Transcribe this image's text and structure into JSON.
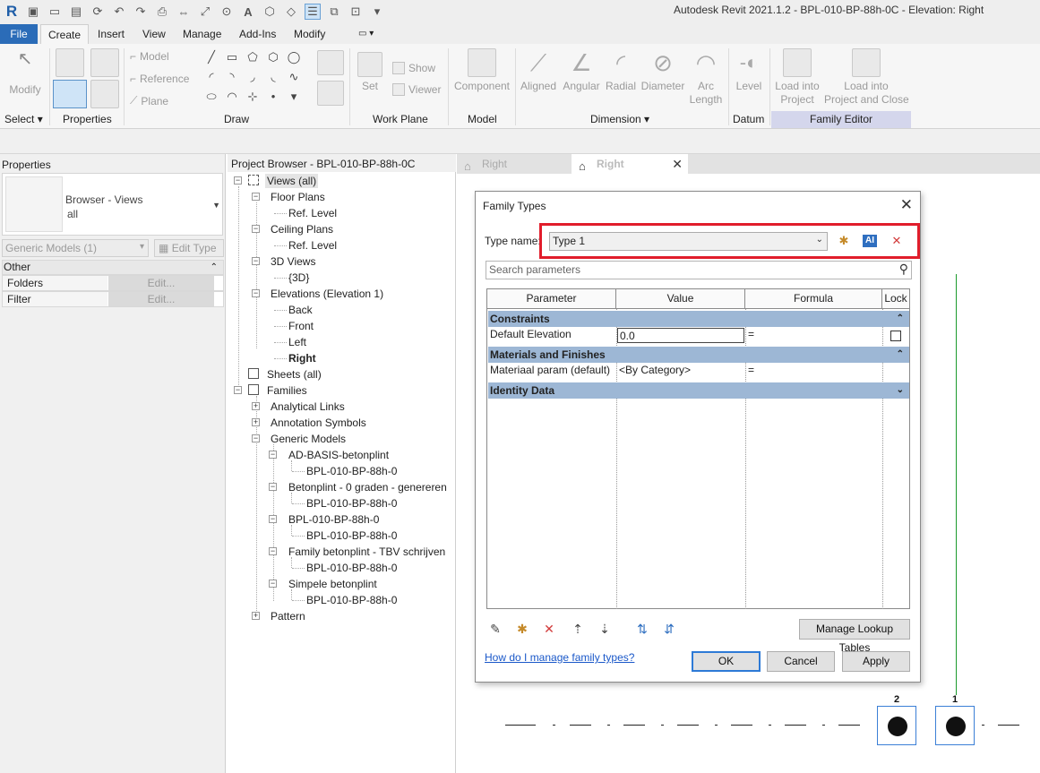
{
  "app": {
    "title": "Autodesk Revit 2021.1.2 - BPL-010-BP-88h-0C - Elevation: Right",
    "logo": "R"
  },
  "menu": {
    "tabs": [
      "File",
      "Create",
      "Insert",
      "View",
      "Manage",
      "Add-Ins",
      "Modify"
    ],
    "active": "Create"
  },
  "ribbon": {
    "modify_label": "Modify",
    "select_label": "Select",
    "properties_label": "Properties",
    "draw_label": "Draw",
    "model_line": "Model",
    "reference_line": "Reference",
    "plane": "Plane",
    "set": "Set",
    "show": "Show",
    "viewer": "Viewer",
    "work_plane_label": "Work Plane",
    "component": "Component",
    "model_label": "Model",
    "aligned": "Aligned",
    "angular": "Angular",
    "radial": "Radial",
    "diameter": "Diameter",
    "arc": "Arc",
    "length": "Length",
    "dimension_label": "Dimension",
    "level": "Level",
    "datum_label": "Datum",
    "load_into": "Load into",
    "project": "Project",
    "load_into2": "Load into",
    "project_and_close": "Project and Close",
    "family_editor_label": "Family Editor"
  },
  "properties": {
    "title": "Properties",
    "type_line1": "Browser - Views",
    "type_line2": "all",
    "filter_combo": "Generic Models (1)",
    "edit_type": "Edit Type",
    "group": "Other",
    "rows": [
      {
        "name": "Folders",
        "value": "Edit..."
      },
      {
        "name": "Filter",
        "value": "Edit..."
      }
    ]
  },
  "browser": {
    "title": "Project Browser - BPL-010-BP-88h-0C",
    "items": [
      "Views (all)",
      "Floor Plans",
      "Ref. Level",
      "Ceiling Plans",
      "Ref. Level",
      "3D Views",
      "{3D}",
      "Elevations (Elevation 1)",
      "Back",
      "Front",
      "Left",
      "Right",
      "Sheets (all)",
      "Families",
      "Analytical Links",
      "Annotation Symbols",
      "Generic Models",
      "AD-BASIS-betonplint",
      "BPL-010-BP-88h-0",
      "Betonplint - 0 graden - genereren",
      "BPL-010-BP-88h-0",
      "BPL-010-BP-88h-0",
      "BPL-010-BP-88h-0",
      "Family betonplint - TBV schrijven",
      "BPL-010-BP-88h-0",
      "Simpele betonplint",
      "BPL-010-BP-88h-0",
      "Pattern"
    ]
  },
  "viewtabs": {
    "tab1": "Right",
    "tab2": "Right"
  },
  "dialog": {
    "title": "Family Types",
    "type_name_label": "Type name:",
    "type_name": "Type 1",
    "search_placeholder": "Search parameters",
    "columns": [
      "Parameter",
      "Value",
      "Formula",
      "Lock"
    ],
    "groups": {
      "constraints": "Constraints",
      "materials": "Materials and Finishes",
      "identity": "Identity Data"
    },
    "rows": {
      "default_elevation": {
        "name": "Default Elevation",
        "value": "0.0",
        "formula": "="
      },
      "material": {
        "name": "Materiaal param (default)",
        "value": "<By Category>",
        "formula": "="
      }
    },
    "manage_lookup": "Manage Lookup Tables",
    "help_link": "How do I manage family types?",
    "ok": "OK",
    "cancel": "Cancel",
    "apply": "Apply"
  },
  "canvas": {
    "grid_bubble_1": "2",
    "grid_bubble_2": "1"
  },
  "colors": {
    "file_tab": "#2b6cb8",
    "highlight_box": "#e11d2b",
    "group_header": "#9db7d5",
    "family_editor_band": "#d4d6ec"
  }
}
